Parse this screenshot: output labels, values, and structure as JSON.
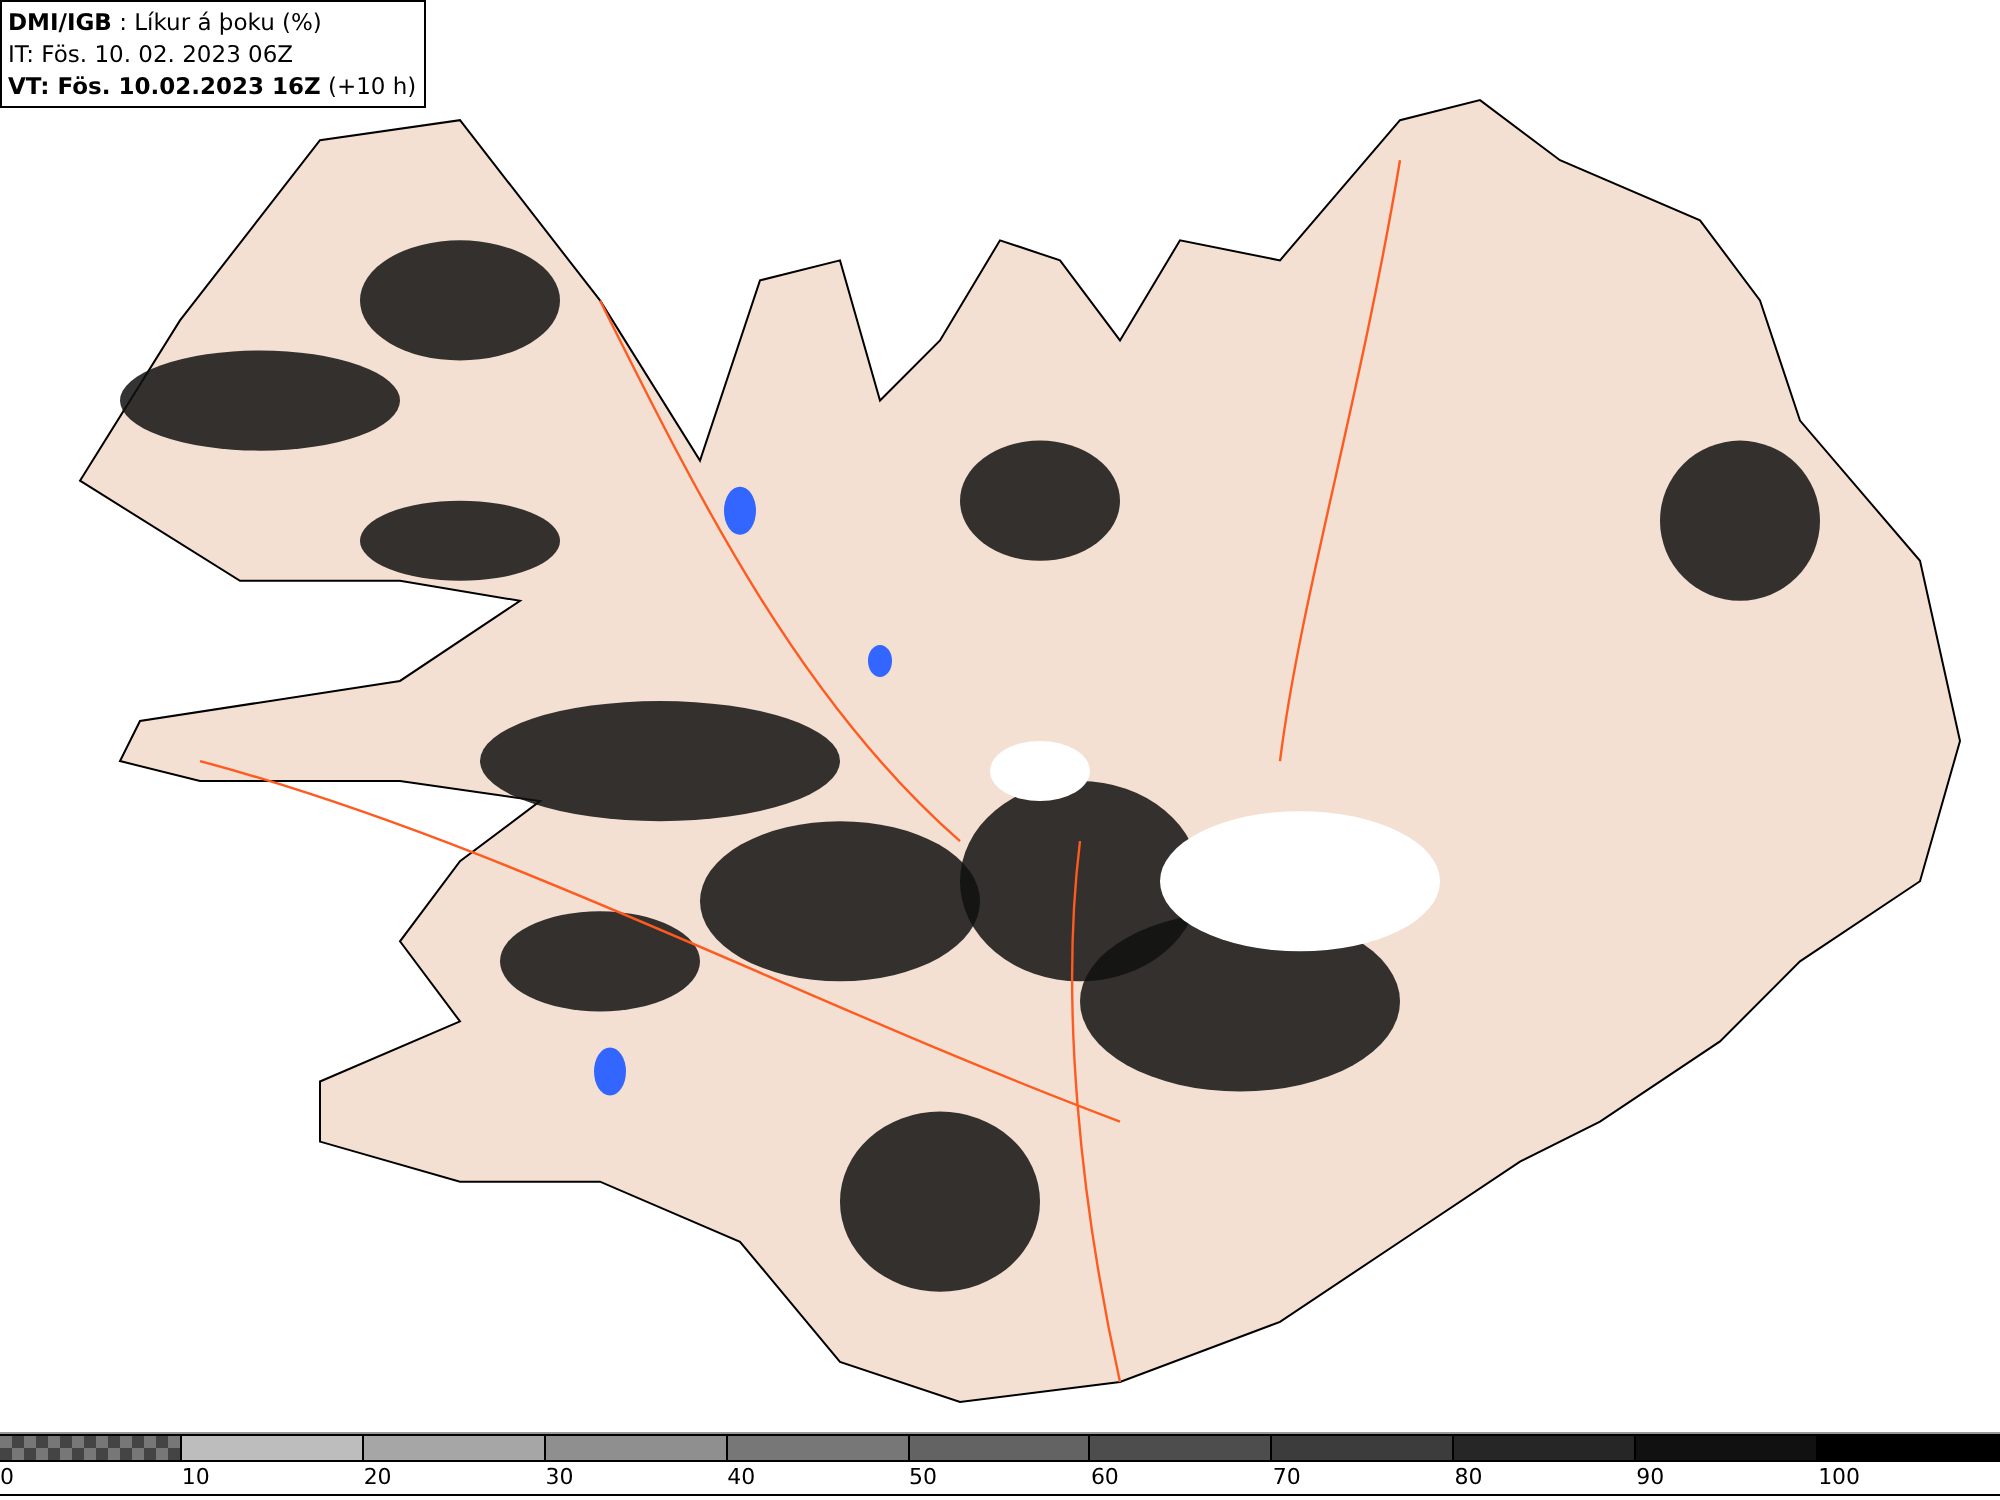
{
  "header": {
    "lines": [
      "**DMI/IGB** : Líkur á þoku (%)",
      "IT: Fös. 10. 02. 2023 06Z",
      "**VT: Fös. 10.02.2023 16Z** (+10 h)"
    ]
  },
  "legend": {
    "segments": [
      {
        "kind": "checkered",
        "color": "#777777"
      },
      {
        "kind": "solid",
        "color": "#bdbdbd"
      },
      {
        "kind": "solid",
        "color": "#a6a6a6"
      },
      {
        "kind": "solid",
        "color": "#8f8f8f"
      },
      {
        "kind": "solid",
        "color": "#777777"
      },
      {
        "kind": "solid",
        "color": "#636363"
      },
      {
        "kind": "solid",
        "color": "#4d4d4d"
      },
      {
        "kind": "solid",
        "color": "#3c3c3c"
      },
      {
        "kind": "solid",
        "color": "#262626"
      },
      {
        "kind": "solid",
        "color": "#111111"
      },
      {
        "kind": "solid",
        "color": "#000000"
      }
    ],
    "labels": [
      "0",
      "10",
      "20",
      "30",
      "40",
      "50",
      "60",
      "70",
      "80",
      "90",
      "100"
    ]
  }
}
